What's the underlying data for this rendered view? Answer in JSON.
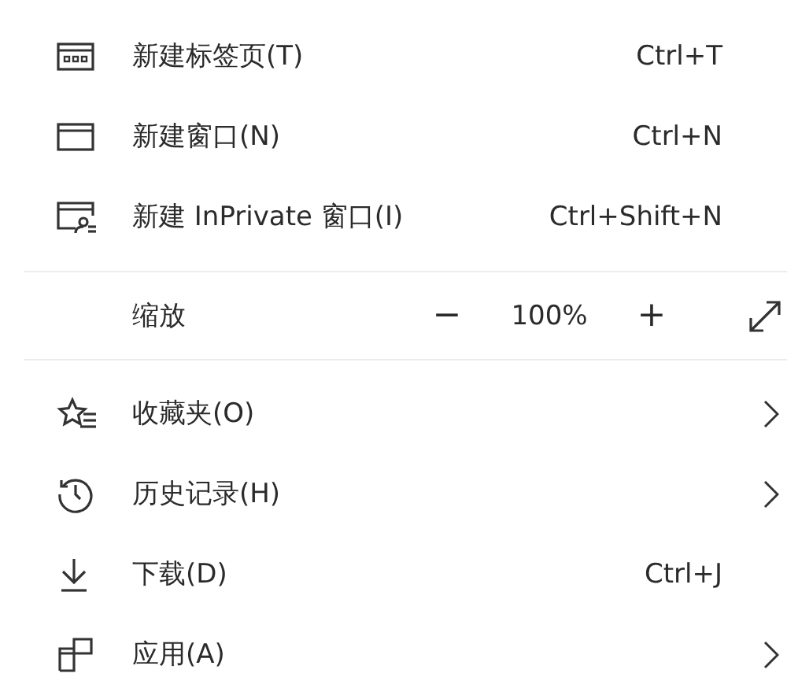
{
  "menu": {
    "items_top": [
      {
        "label": "新建标签页(T)",
        "shortcut": "Ctrl+T",
        "submenu": false
      },
      {
        "label": "新建窗口(N)",
        "shortcut": "Ctrl+N",
        "submenu": false
      },
      {
        "label": "新建 InPrivate 窗口(I)",
        "shortcut": "Ctrl+Shift+N",
        "submenu": false
      }
    ],
    "zoom": {
      "label": "缩放",
      "decrease": "−",
      "value": "100%",
      "increase": "+"
    },
    "items_bottom": [
      {
        "label": "收藏夹(O)",
        "submenu": true
      },
      {
        "label": "历史记录(H)",
        "submenu": true
      },
      {
        "label": "下载(D)",
        "shortcut": "Ctrl+J",
        "submenu": false
      },
      {
        "label": "应用(A)",
        "submenu": true
      }
    ]
  }
}
